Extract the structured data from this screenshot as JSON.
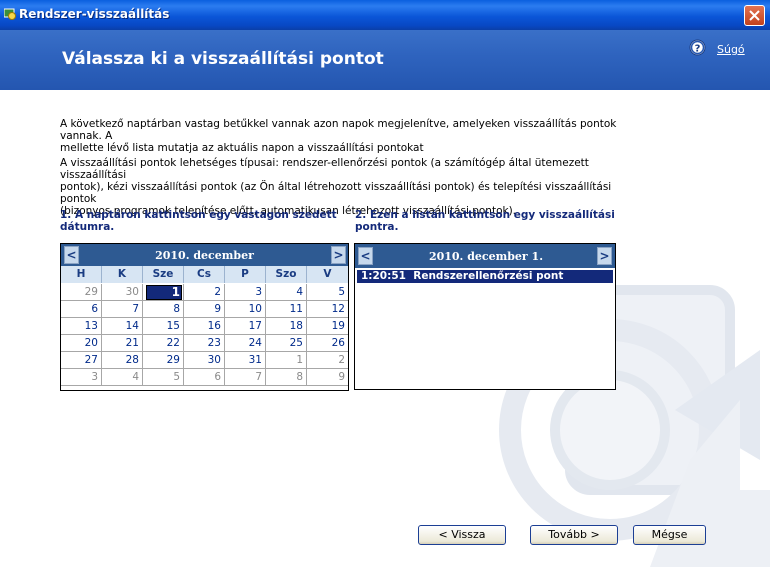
{
  "window": {
    "title": "Rendszer-visszaállítás",
    "icons": {
      "app": "system-restore-icon",
      "close": "close-icon"
    }
  },
  "header": {
    "title": "Válassza ki a visszaállítási pontot",
    "help_label": "Súgó",
    "help_icon": "question-icon"
  },
  "intro": {
    "line1": "A következő naptárban vastag betűkkel vannak azon napok megjelenítve, amelyeken visszaállítás pontok vannak. A",
    "line2": "mellette lévő lista mutatja az aktuális napon a visszaállítási pontokat"
  },
  "types": {
    "line1": "A visszaállítási pontok lehetséges típusai: rendszer-ellenőrzési pontok (a számítógép által ütemezett visszaállítási",
    "line2": "pontok), kézi visszaállítási pontok (az Ön által létrehozott visszaállítási pontok) és telepítési visszaállítási pontok",
    "line3": "(bizonyos programok telepítése előtt, automatikusan létrehozott visszaállítási pontok)."
  },
  "step1": {
    "line1": "1. A naptáron kattintson egy vastagon szedett",
    "line2": "dátumra."
  },
  "step2": {
    "line1": "2. Ezen a listán kattintson egy visszaállítási",
    "line2": "pontra."
  },
  "calendar": {
    "title": "2010. december",
    "prev": "<",
    "next": ">",
    "weekdays": [
      "H",
      "K",
      "Sze",
      "Cs",
      "P",
      "Szo",
      "V"
    ],
    "weeks": [
      [
        "29",
        "30",
        "1",
        "2",
        "3",
        "4",
        "5"
      ],
      [
        "6",
        "7",
        "8",
        "9",
        "10",
        "11",
        "12"
      ],
      [
        "13",
        "14",
        "15",
        "16",
        "17",
        "18",
        "19"
      ],
      [
        "20",
        "21",
        "22",
        "23",
        "24",
        "25",
        "26"
      ],
      [
        "27",
        "28",
        "29",
        "30",
        "31",
        "1",
        "2"
      ],
      [
        "3",
        "4",
        "5",
        "6",
        "7",
        "8",
        "9"
      ]
    ],
    "selected": "1"
  },
  "restore_list": {
    "title": "2010. december 1.",
    "prev": "<",
    "next": ">",
    "items": [
      {
        "time": "1:20:51",
        "label": "Rendszerellenőrzési pont"
      }
    ]
  },
  "buttons": {
    "back": "< Vissza",
    "next": "Tovább >",
    "cancel": "Mégse"
  }
}
